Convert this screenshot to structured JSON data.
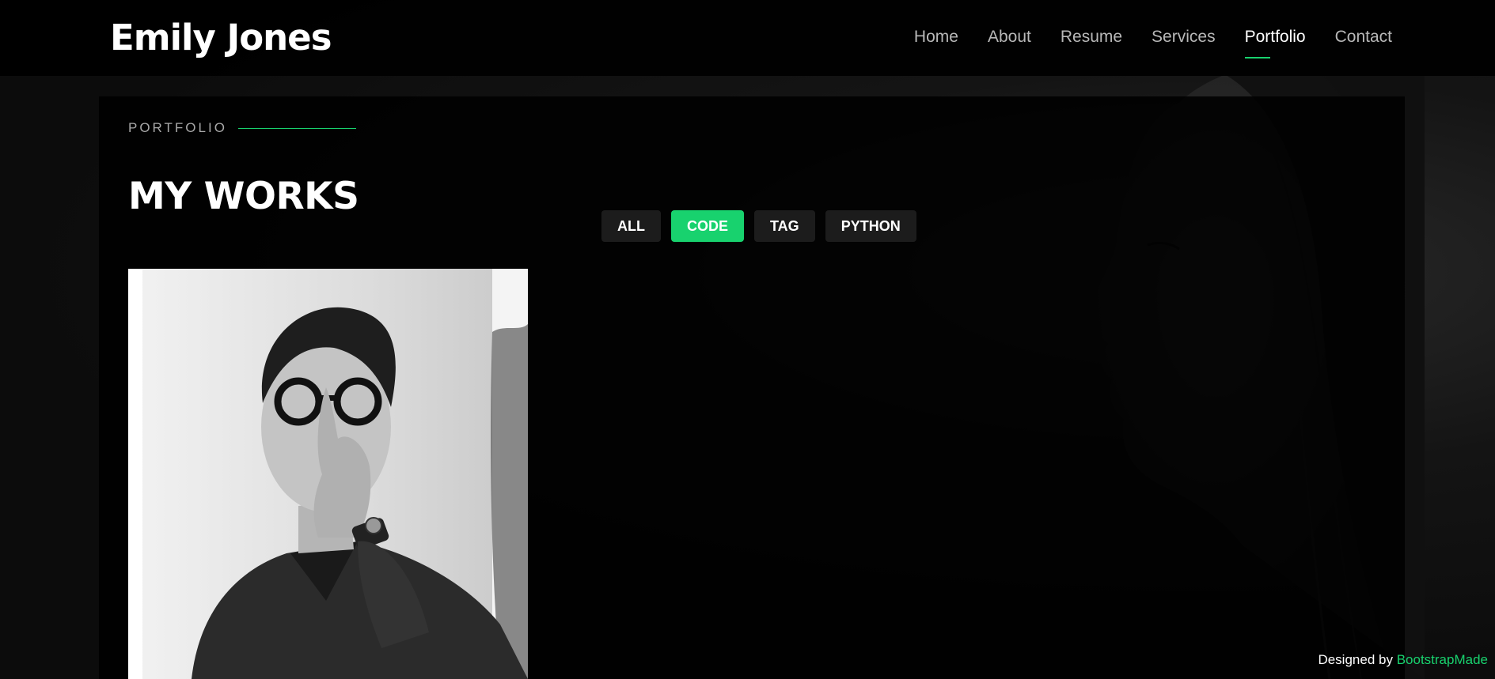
{
  "header": {
    "logo": "Emily Jones",
    "nav": [
      {
        "label": "Home"
      },
      {
        "label": "About"
      },
      {
        "label": "Resume"
      },
      {
        "label": "Services"
      },
      {
        "label": "Portfolio",
        "active": true
      },
      {
        "label": "Contact"
      }
    ]
  },
  "portfolio": {
    "subtitle": "PORTFOLIO",
    "title": "MY WORKS",
    "filters": [
      {
        "label": "ALL"
      },
      {
        "label": "CODE",
        "active": true
      },
      {
        "label": "TAG"
      },
      {
        "label": "PYTHON"
      }
    ]
  },
  "footer": {
    "credit_prefix": "Designed by",
    "credit_link": "BootstrapMade"
  },
  "colors": {
    "accent": "#18d26e",
    "background": "#0a0a0a",
    "filter_bg": "#1c1c1c"
  }
}
